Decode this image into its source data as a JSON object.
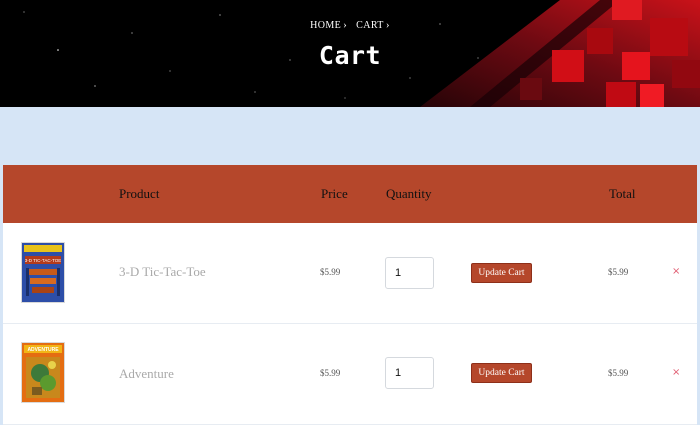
{
  "breadcrumb": [
    {
      "label": "HOME",
      "sep": "›"
    },
    {
      "label": "CART",
      "sep": "›"
    }
  ],
  "page_title": "Cart",
  "table": {
    "headers": {
      "product": "Product",
      "price": "Price",
      "quantity": "Quantity",
      "total": "Total"
    },
    "update_label": "Update Cart",
    "remove_glyph": "×",
    "rows": [
      {
        "product": "3-D Tic-Tac-Toe",
        "price": "$5.99",
        "quantity": "1",
        "total": "$5.99",
        "cover_text": "3-D TIC-TAC-TOE",
        "cover_color": "#2d4ea8"
      },
      {
        "product": "Adventure",
        "price": "$5.99",
        "quantity": "1",
        "total": "$5.99",
        "cover_text": "ADVENTURE",
        "cover_color": "#e46d12"
      }
    ]
  },
  "colors": {
    "accent": "#b5472b",
    "page_bg": "#d6e5f6",
    "hero_bg": "#000000",
    "remove": "#e05a6f"
  }
}
